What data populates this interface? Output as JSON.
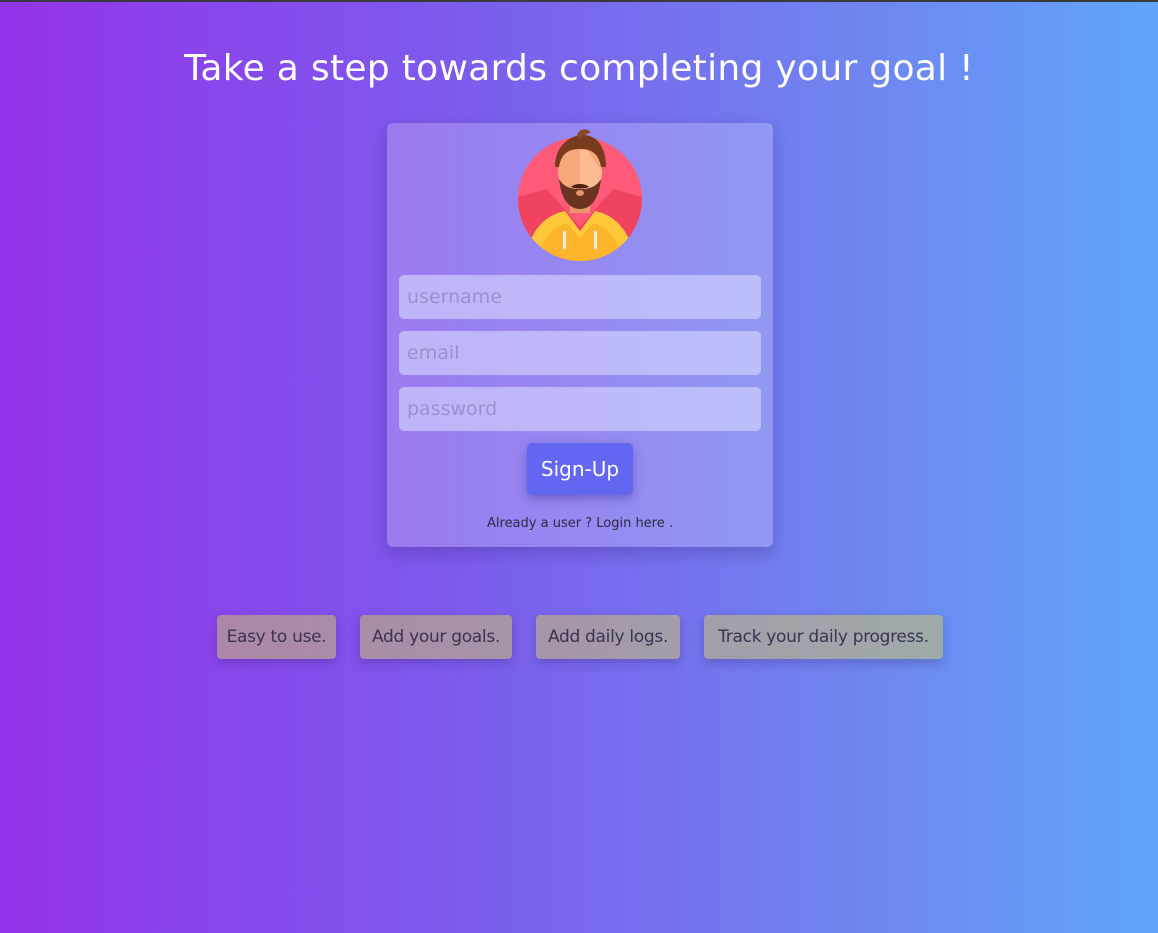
{
  "heading": "Take a step towards completing your goal !",
  "form": {
    "username_placeholder": "username",
    "email_placeholder": "email",
    "password_placeholder": "password",
    "signup_label": "Sign-Up",
    "login_prefix": "Already a user ? ",
    "login_link": "Login here ."
  },
  "features": [
    "Easy to use.",
    "Add your goals.",
    "Add daily logs.",
    "Track your daily progress."
  ],
  "colors": {
    "gradient_start": "#9333ea",
    "gradient_end": "#60a5fa",
    "button": "#6366f1"
  },
  "icons": {
    "avatar": "bearded-man-avatar-icon"
  }
}
